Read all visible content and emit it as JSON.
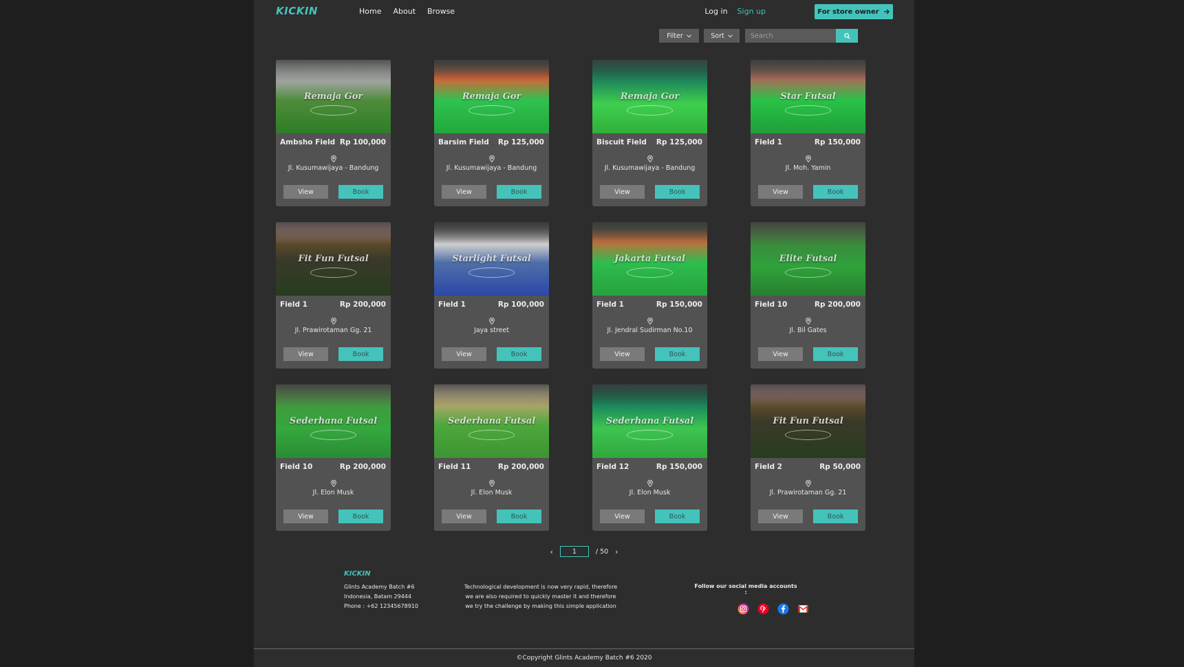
{
  "header": {
    "logo": "KICKIN",
    "nav": [
      "Home",
      "About",
      "Browse"
    ],
    "login": "Log in",
    "signup": "Sign up",
    "owner_button": "For store owner"
  },
  "toolbar": {
    "filter": "Filter",
    "sort": "Sort",
    "search_placeholder": "Search"
  },
  "fields": [
    {
      "image_title": "Remaja Gor",
      "name": "Ambsho Field",
      "price": "Rp 100,000",
      "address": "Jl. Kusumawijaya - Bandung"
    },
    {
      "image_title": "Remaja Gor",
      "name": "Barsim Field",
      "price": "Rp 125,000",
      "address": "Jl. Kusumawijaya - Bandung"
    },
    {
      "image_title": "Remaja Gor",
      "name": "Biscuit Field",
      "price": "Rp 125,000",
      "address": "Jl. Kusumawijaya - Bandung"
    },
    {
      "image_title": "Star Futsal",
      "name": "Field 1",
      "price": "Rp 150,000",
      "address": "Jl. Moh. Yamin"
    },
    {
      "image_title": "Fit Fun Futsal",
      "name": "Field 1",
      "price": "Rp 200,000",
      "address": "Jl. Prawirotaman Gg. 21"
    },
    {
      "image_title": "Starlight Futsal",
      "name": "Field 1",
      "price": "Rp 100,000",
      "address": "Jaya street"
    },
    {
      "image_title": "Jakarta Futsal",
      "name": "Field 1",
      "price": "Rp 150,000",
      "address": "Jl. Jendral Sudirman No.10"
    },
    {
      "image_title": "Elite Futsal",
      "name": "Field 10",
      "price": "Rp 200,000",
      "address": "Jl. Bil Gates"
    },
    {
      "image_title": "Sederhana Futsal",
      "name": "Field 10",
      "price": "Rp 200,000",
      "address": "Jl. Elon Musk"
    },
    {
      "image_title": "Sederhana Futsal",
      "name": "Field 11",
      "price": "Rp 200,000",
      "address": "Jl. Elon Musk"
    },
    {
      "image_title": "Sederhana Futsal",
      "name": "Field 12",
      "price": "Rp 150,000",
      "address": "Jl. Elon Musk"
    },
    {
      "image_title": "Fit Fun Futsal",
      "name": "Field 2",
      "price": "Rp 50,000",
      "address": "Jl. Prawirotaman Gg. 21"
    }
  ],
  "card_buttons": {
    "view": "View",
    "book": "Book"
  },
  "pagination": {
    "current": "1",
    "total_label": "/ 50"
  },
  "footer": {
    "logo": "KICKIN",
    "address_lines": [
      "Glints Academy Batch #6",
      "Indonesia, Batam 29444",
      "Phone : +62 12345678910"
    ],
    "description_lines": [
      "Technological development is now very rapid, therefore",
      "we are also required to quickly master it and therefore",
      "we try the challenge by making this simple application"
    ],
    "follow_label": "Follow our social media accounts :",
    "social_icons": [
      "instagram-icon",
      "pinterest-icon",
      "facebook-icon",
      "mail-icon"
    ],
    "copyright": "©Copyright Glints Academy Batch #6 2020"
  },
  "colors": {
    "accent": "#44c3bb",
    "card": "#525252",
    "page": "#2d2d2d",
    "background": "#1e1e1e"
  }
}
